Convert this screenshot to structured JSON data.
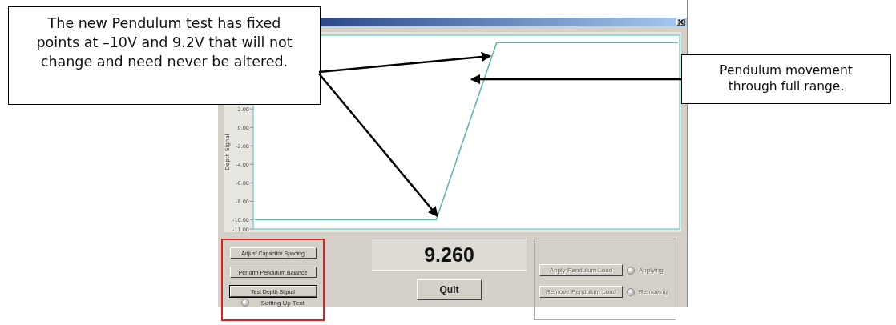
{
  "window": {
    "chart": {
      "chart_data": {
        "type": "line",
        "ylabel": "Depth Signal",
        "series": [
          {
            "color": "#5fb8b0",
            "values": [
              -10,
              -10,
              -10,
              -10,
              -10,
              -10,
              -10,
              -0.4,
              9.2,
              9.2,
              9.2,
              9.2,
              9.2,
              9.2,
              9.2
            ]
          }
        ],
        "ylim": [
          -11,
          10
        ],
        "yticks": [
          {
            "value": -11,
            "label": "-11.00"
          },
          {
            "value": -10,
            "label": "-10.00"
          },
          {
            "value": -8,
            "label": "-8.00"
          },
          {
            "value": -6,
            "label": "-6.00"
          },
          {
            "value": -4,
            "label": "-4.00"
          },
          {
            "value": -2,
            "label": "-2.00"
          },
          {
            "value": 0,
            "label": "0.00"
          },
          {
            "value": 2,
            "label": "2.00"
          }
        ]
      }
    },
    "setup_buttons": [
      {
        "label": "Adjust Capacitor Spacing",
        "focused": false
      },
      {
        "label": "Perform Pendulum Balance",
        "focused": false
      },
      {
        "label": "Test Depth Signal",
        "focused": true
      }
    ],
    "setup_status": {
      "label": "Setting Up Test",
      "on": false
    },
    "reading": "9.260",
    "quit_button": "Quit",
    "load_controls": [
      {
        "button": "Apply Pendulum Load",
        "disabled": true,
        "status": "Applying",
        "on": false
      },
      {
        "button": "Remove Pendulum Load",
        "disabled": true,
        "status": "Removing",
        "on": false
      }
    ]
  },
  "callouts": [
    {
      "text": "The new Pendulum test has fixed points at –10V and 9.2V that will not change and need never be altered."
    },
    {
      "text": "Pendulum movement through full range."
    }
  ]
}
